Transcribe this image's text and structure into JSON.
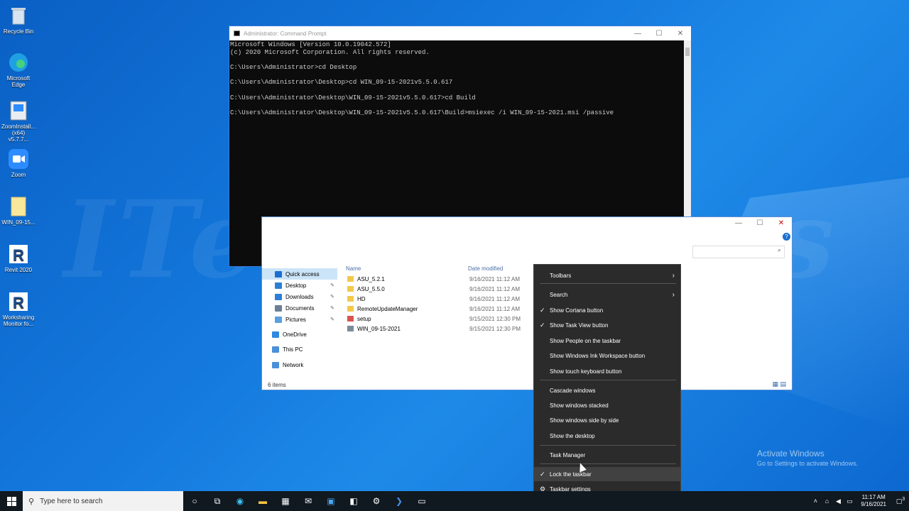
{
  "desktop_icons": [
    {
      "label": "Recycle Bin",
      "icon": "recycle-bin-icon"
    },
    {
      "label": "Microsoft Edge",
      "icon": "edge-icon"
    },
    {
      "label": "ZoomInstall... (x64) v5.7.7...",
      "icon": "installer-icon"
    },
    {
      "label": "Zoom",
      "icon": "zoom-icon"
    },
    {
      "label": "WIN_09-15...",
      "icon": "folder-icon"
    },
    {
      "label": "Revit 2020",
      "icon": "revit-icon"
    },
    {
      "label": "Worksharing Monitor fo...",
      "icon": "worksharing-icon"
    }
  ],
  "cmd": {
    "title": "Administrator: Command Prompt",
    "lines": [
      "Microsoft Windows [Version 10.0.19042.572]",
      "(c) 2020 Microsoft Corporation. All rights reserved.",
      "",
      "C:\\Users\\Administrator>cd Desktop",
      "",
      "C:\\Users\\Administrator\\Desktop>cd WIN_09-15-2021v5.5.0.617",
      "",
      "C:\\Users\\Administrator\\Desktop\\WIN_09-15-2021v5.5.0.617>cd Build",
      "",
      "C:\\Users\\Administrator\\Desktop\\WIN_09-15-2021v5.5.0.617\\Build>msiexec /i WIN_09-15-2021.msi /passive"
    ]
  },
  "explorer": {
    "nav": [
      {
        "label": "Quick access",
        "pinned": false,
        "selected": true
      },
      {
        "label": "Desktop",
        "pinned": true,
        "selected": false
      },
      {
        "label": "Downloads",
        "pinned": true,
        "selected": false
      },
      {
        "label": "Documents",
        "pinned": true,
        "selected": false
      },
      {
        "label": "Pictures",
        "pinned": true,
        "selected": false
      },
      {
        "label": "OneDrive",
        "pinned": false,
        "selected": false
      },
      {
        "label": "This PC",
        "pinned": false,
        "selected": false
      },
      {
        "label": "Network",
        "pinned": false,
        "selected": false
      }
    ],
    "columns": {
      "name": "Name",
      "date": "Date modified"
    },
    "files": [
      {
        "name": "ASU_5.2.1",
        "date": "9/16/2021 11:12 AM",
        "type": "folder"
      },
      {
        "name": "ASU_5.5.0",
        "date": "9/16/2021 11:12 AM",
        "type": "folder"
      },
      {
        "name": "HD",
        "date": "9/16/2021 11:12 AM",
        "type": "folder"
      },
      {
        "name": "RemoteUpdateManager",
        "date": "9/16/2021 11:12 AM",
        "type": "folder"
      },
      {
        "name": "setup",
        "date": "9/15/2021 12:30 PM",
        "type": "exe"
      },
      {
        "name": "WIN_09-15-2021",
        "date": "9/15/2021 12:30 PM",
        "type": "msi"
      }
    ],
    "status": "6 items"
  },
  "context_menu": {
    "items": [
      {
        "label": "Toolbars",
        "checked": false,
        "submenu": true
      },
      {
        "label": "Search",
        "checked": false,
        "submenu": true
      },
      {
        "label": "Show Cortana button",
        "checked": true,
        "submenu": false
      },
      {
        "label": "Show Task View button",
        "checked": true,
        "submenu": false
      },
      {
        "label": "Show People on the taskbar",
        "checked": false,
        "submenu": false
      },
      {
        "label": "Show Windows Ink Workspace button",
        "checked": false,
        "submenu": false
      },
      {
        "label": "Show touch keyboard button",
        "checked": false,
        "submenu": false
      },
      {
        "label": "Cascade windows",
        "checked": false,
        "submenu": false
      },
      {
        "label": "Show windows stacked",
        "checked": false,
        "submenu": false
      },
      {
        "label": "Show windows side by side",
        "checked": false,
        "submenu": false
      },
      {
        "label": "Show the desktop",
        "checked": false,
        "submenu": false
      },
      {
        "label": "Task Manager",
        "checked": false,
        "submenu": false
      },
      {
        "label": "Lock the taskbar",
        "checked": true,
        "submenu": false,
        "hover": true
      },
      {
        "label": "Taskbar settings",
        "checked": false,
        "submenu": false,
        "gear": true
      }
    ]
  },
  "activation": {
    "title": "Activate Windows",
    "subtitle": "Go to Settings to activate Windows."
  },
  "watermark": "ITechXpress",
  "taskbar": {
    "search_placeholder": "Type here to search",
    "time": "11:17 AM",
    "date": "9/16/2021",
    "notification_count": "3"
  }
}
